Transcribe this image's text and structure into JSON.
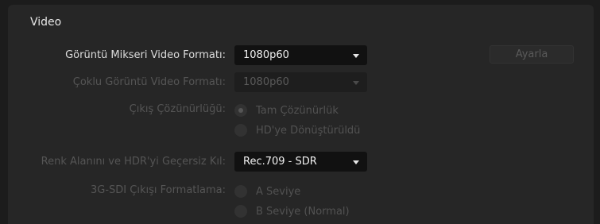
{
  "section": {
    "title": "Video"
  },
  "mixer_format": {
    "label": "Görüntü Mikseri Video Formatı:",
    "value": "1080p60"
  },
  "setup_button": {
    "label": "Ayarla"
  },
  "multiview_format": {
    "label": "Çoklu Görüntü Video Formatı:",
    "value": "1080p60"
  },
  "output_resolution": {
    "label": "Çıkış Çözünürlüğü:",
    "options": [
      "Tam Çözünürlük",
      "HD'ye Dönüştürüldü"
    ],
    "selected": 0
  },
  "color_space": {
    "label": "Renk Alanını ve HDR'yi Geçersiz Kıl:",
    "value": "Rec.709 - SDR"
  },
  "sdi_formatting": {
    "label": "3G-SDI Çıkışı Formatlama:",
    "options": [
      "A Seviye",
      "B Seviye (Normal)"
    ],
    "selected": -1
  }
}
